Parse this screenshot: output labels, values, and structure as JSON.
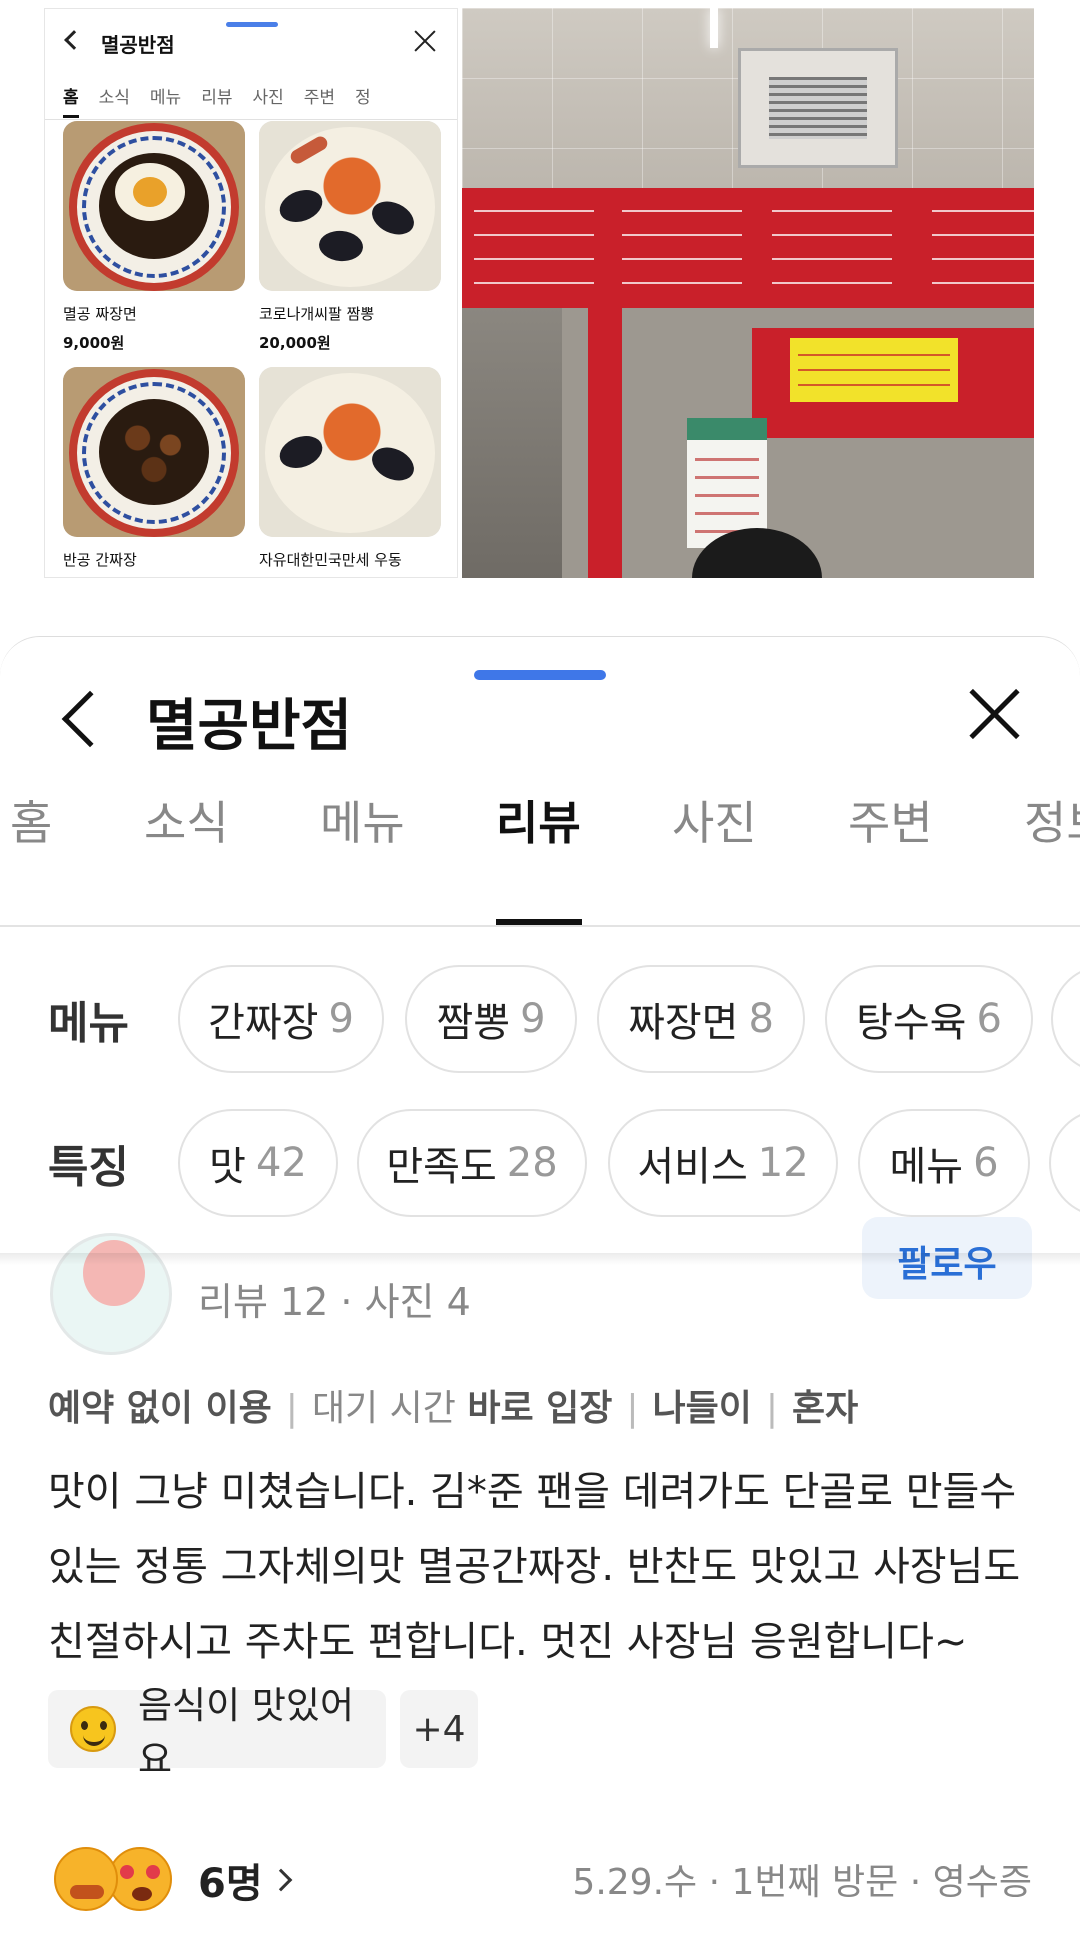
{
  "mini_panel": {
    "title": "멸공반점",
    "tabs": [
      "홈",
      "소식",
      "메뉴",
      "리뷰",
      "사진",
      "주변",
      "정"
    ],
    "menu_items": [
      {
        "name": "멸공 짜장면",
        "price": "9,000원"
      },
      {
        "name": "코로나개씨팔 짬뽕",
        "price": "20,000원"
      },
      {
        "name": "반공 간짜장",
        "price": ""
      },
      {
        "name": "자유대한민국만세 우동",
        "price": ""
      }
    ]
  },
  "header": {
    "title": "멸공반점"
  },
  "tabs": [
    "홈",
    "소식",
    "메뉴",
    "리뷰",
    "사진",
    "주변",
    "정보"
  ],
  "active_tab": "리뷰",
  "filters": {
    "menu_label": "메뉴",
    "menu_chips": [
      {
        "label": "간짜장",
        "count": "9"
      },
      {
        "label": "짬뽕",
        "count": "9"
      },
      {
        "label": "짜장면",
        "count": "8"
      },
      {
        "label": "탕수육",
        "count": "6"
      }
    ],
    "feature_label": "특징",
    "feature_chips": [
      {
        "label": "맛",
        "count": "42"
      },
      {
        "label": "만족도",
        "count": "28"
      },
      {
        "label": "서비스",
        "count": "12"
      },
      {
        "label": "메뉴",
        "count": "6"
      }
    ]
  },
  "review": {
    "reviewer_stats": "리뷰 12 · 사진 4",
    "follow_label": "팔로우",
    "visit_info": {
      "reservation_value": "예약 없이 이용",
      "wait_label": "대기 시간",
      "wait_value": "바로 입장",
      "purpose": "나들이",
      "companion": "혼자"
    },
    "text": "맛이 그냥 미쳤습니다. 김*준 팬을 데려가도 단골로 만들수 있는 정통 그자체의맛 멸공간짜장. 반찬도 맛있고 사장님도 친절하시고 주차도 편합니다. 멋진 사장님 응원합니다~",
    "keyword": "음식이 맛있어요",
    "more_keywords": "+4",
    "reaction_count": "6명",
    "meta": "5.29.수 · 1번째 방문 · 영수증"
  }
}
